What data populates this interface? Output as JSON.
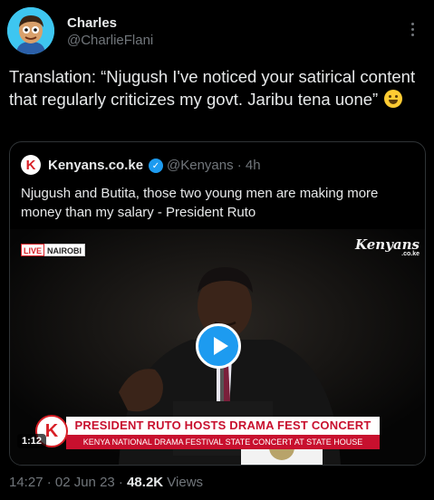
{
  "author": {
    "name": "Charles",
    "handle": "@CharlieFlani"
  },
  "post": {
    "text": "Translation: “Njugush I've noticed your satirical content that regularly criticizes my govt. Jaribu tena uone”",
    "emoji": "grinning-sweat-face"
  },
  "quote": {
    "name": "Kenyans.co.ke",
    "logo_letter": "K",
    "handle_time": "@Kenyans · 4h",
    "text": "Njugush and Butita, those two young men are making more money than my salary - President Ruto",
    "media": {
      "live_label": "LIVE",
      "location_label": "NAIROBI",
      "brand": "Kenyans",
      "brand_sub": ".co.ke",
      "headline": "PRESIDENT RUTO HOSTS DRAMA FEST CONCERT",
      "subheadline": "KENYA NATIONAL DRAMA FESTIVAL STATE CONCERT AT STATE HOUSE",
      "duration": "1:12"
    }
  },
  "meta": {
    "time_date": "14:27 · 02 Jun 23 · ",
    "views_count": "48.2K",
    "views_label": " Views"
  },
  "colors": {
    "background": "#000000",
    "accent": "#1d9bf0",
    "muted": "#71767b",
    "brand_red": "#c8102e"
  }
}
